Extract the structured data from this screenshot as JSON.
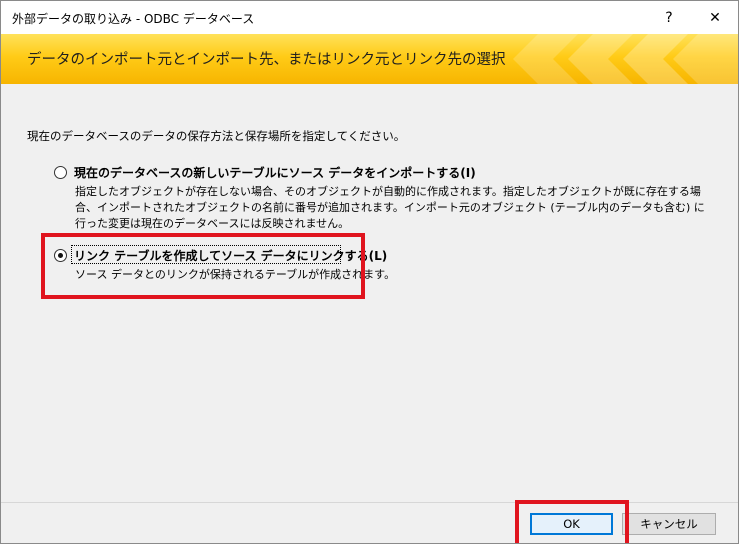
{
  "window": {
    "title": "外部データの取り込み - ODBC データベース",
    "help_label": "?",
    "close_label": "✕"
  },
  "banner": {
    "title": "データのインポート元とインポート先、またはリンク元とリンク先の選択",
    "colors": {
      "top": "#ffe25a",
      "bottom": "#f7b500"
    }
  },
  "content": {
    "instruction": "現在のデータベースのデータの保存方法と保存場所を指定してください。",
    "options": [
      {
        "label": "現在のデータベースの新しいテーブルにソース データをインポートする(I)",
        "description": "指定したオブジェクトが存在しない場合、そのオブジェクトが自動的に作成されます。指定したオブジェクトが既に存在する場合、インポートされたオブジェクトの名前に番号が追加されます。インポート元のオブジェクト (テーブル内のデータも含む) に行った変更は現在のデータベースには反映されません。",
        "selected": false
      },
      {
        "label": "リンク テーブルを作成してソース データにリンクする(L)",
        "description": "ソース データとのリンクが保持されるテーブルが作成されます。",
        "selected": true
      }
    ]
  },
  "footer": {
    "ok_label": "OK",
    "cancel_label": "キャンセル"
  },
  "highlight_color": "#e0141e"
}
